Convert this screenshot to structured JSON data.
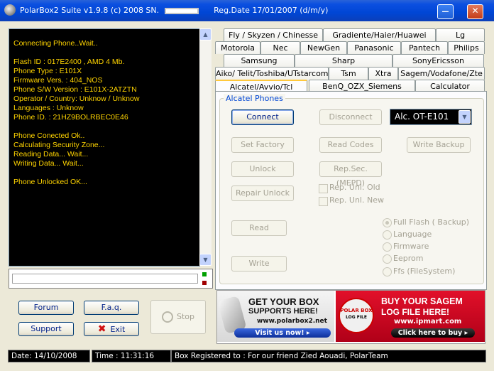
{
  "window": {
    "title_left": "PolarBox2 Suite  v1.9.8 (c) 2008     SN.",
    "title_right": "Reg.Date 17/01/2007 (d/m/y)",
    "minimize_glyph": "—",
    "close_glyph": "✕"
  },
  "log": {
    "lines": [
      "Connecting Phone..Wait..",
      "",
      "Flash ID : 017E2400 ,  AMD 4 Mb.",
      "Phone Type : E101X",
      "Firmware Vers. : 404_NOS",
      "Phone S/W Version : E101X-2ATZTN",
      "Operator / Country: Unknow / Unknow",
      "Languages : Unknow",
      "Phone ID. : 21HZ9BOLRBEC0E46",
      "",
      "Phone Conected Ok..",
      "Calculating Security Zone...",
      "Reading Data... Wait...",
      "Writing Data... Wait...",
      "",
      "Phone Unlocked OK..."
    ]
  },
  "leds": {
    "top_color": "#00a000",
    "bottom_color": "#a00000"
  },
  "left_buttons": {
    "forum": "Forum",
    "faq": "F.a.q.",
    "support": "Support",
    "exit": "Exit",
    "stop": "Stop"
  },
  "tabs": {
    "row1": [
      "Fly / Skyzen / Chinesse",
      "Gradiente/Haier/Huawei",
      "Lg"
    ],
    "row2": [
      "Motorola",
      "Nec",
      "NewGen",
      "Panasonic",
      "Pantech",
      "Philips"
    ],
    "row3": [
      "Samsung",
      "Sharp",
      "SonyEricsson"
    ],
    "row4": [
      "Aiko/ Telit/Toshiba/UTstarcom",
      "Tsm",
      "Xtra",
      "Sagem/Vodafone/Zte"
    ],
    "row5": [
      "Alcatel/Avvio/Tcl",
      "BenQ_OZX_Siemens",
      "Calculator"
    ]
  },
  "alcatel": {
    "group_title": "Alcatel Phones",
    "connect": "Connect",
    "disconnect": "Disconnect",
    "model": "Alc. OT-E101",
    "factory": "Set Factory",
    "read_codes": "Read Codes",
    "write_backup": "Write Backup",
    "unlock": "Unlock",
    "rep_sec": "Rep.Sec.(MEPD)",
    "repair_unlock": "Repair Unlock",
    "rep_unl_old": "Rep. Unl. Old",
    "rep_unl_new": "Rep. Unl. New",
    "read": "Read",
    "write": "Write",
    "options": [
      "Full Flash ( Backup)",
      "Language",
      "Firmware",
      "Eeprom",
      "Ffs (FileSystem)"
    ]
  },
  "banner": {
    "left_line1": "GET YOUR BOX",
    "left_line2": "SUPPORTS HERE!",
    "left_url": "www.polarbox2.net",
    "left_cta": "Visit us now!",
    "logo_text": "POLAR BOX",
    "logo_sub": "LOG FILE",
    "right_line1": "BUY YOUR SAGEM",
    "right_line2": "LOG FILE HERE!",
    "right_url": "www.ipmart.com",
    "right_cta": "Click here to buy"
  },
  "status": {
    "date": "Date: 14/10/2008",
    "time": "Time :  11:31:16",
    "registered": "Box  Registered to : For our friend Zied Aouadi, PolarTeam"
  }
}
